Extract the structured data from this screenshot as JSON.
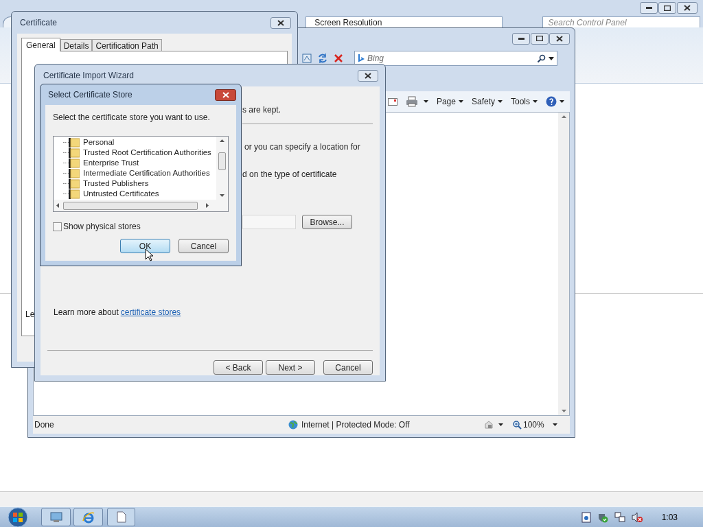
{
  "control_panel": {
    "address": "Screen Resolution",
    "search": {
      "placeholder": "Search Control Panel"
    }
  },
  "browser": {
    "search": {
      "placeholder": "Bing"
    },
    "commands": [
      {
        "label": "Page"
      },
      {
        "label": "Safety"
      },
      {
        "label": "Tools"
      }
    ],
    "status_bar": {
      "text": "Done",
      "zone": "Internet | Protected Mode: Off",
      "zoom": "100%"
    }
  },
  "certificate_window": {
    "title": "Certificate",
    "tabs": [
      {
        "label": "General",
        "selected": true
      },
      {
        "label": "Details",
        "selected": false
      },
      {
        "label": "Certification Path",
        "selected": false
      }
    ],
    "visible_text": "Le"
  },
  "import_wizard": {
    "title": "Certificate Import Wizard",
    "text_fragments": [
      "s are kept.",
      "or you can specify a location for",
      "d on the type of certificate"
    ],
    "browse_button": "Browse...",
    "learn_more": "Learn more about",
    "link": "certificate stores",
    "buttons": [
      "< Back",
      "Next >",
      "Cancel"
    ]
  },
  "store_dialog": {
    "title": "Select Certificate Store",
    "prompt": "Select the certificate store you want to use.",
    "stores": [
      {
        "label": "Personal",
        "selected": false
      },
      {
        "label": "Trusted Root Certification Authorities",
        "selected": false
      },
      {
        "label": "Enterprise Trust",
        "selected": false
      },
      {
        "label": "Intermediate Certification Authorities",
        "selected": false
      },
      {
        "label": "Trusted Publishers",
        "selected": false
      },
      {
        "label": "Untrusted Certificates",
        "selected": false
      }
    ],
    "show_physical": {
      "label": "Show physical stores",
      "checked": false
    },
    "buttons": [
      {
        "label": "OK",
        "default": true
      },
      {
        "label": "Cancel",
        "default": false
      }
    ]
  },
  "taskbar": {
    "clock": "1:03"
  }
}
